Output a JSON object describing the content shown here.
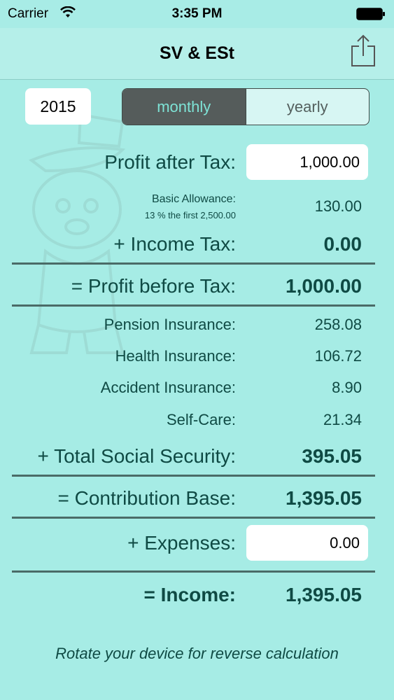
{
  "status_bar": {
    "carrier": "Carrier",
    "time": "3:35 PM"
  },
  "nav": {
    "title": "SV & ESt",
    "share_icon": "share-icon"
  },
  "controls": {
    "year": "2015",
    "segments": [
      "monthly",
      "yearly"
    ],
    "selected_segment": "monthly"
  },
  "rows": {
    "profit_after_tax": {
      "label": "Profit after Tax:",
      "value": "1,000.00"
    },
    "basic_allowance": {
      "label": "Basic Allowance:",
      "sublabel": "13 % the first 2,500.00",
      "value": "130.00"
    },
    "income_tax": {
      "label": "+ Income Tax:",
      "value": "0.00"
    },
    "profit_before_tax": {
      "label": "= Profit before Tax:",
      "value": "1,000.00"
    },
    "pension_insurance": {
      "label": "Pension Insurance:",
      "value": "258.08"
    },
    "health_insurance": {
      "label": "Health Insurance:",
      "value": "106.72"
    },
    "accident_insurance": {
      "label": "Accident Insurance:",
      "value": "8.90"
    },
    "self_care": {
      "label": "Self-Care:",
      "value": "21.34"
    },
    "total_social_security": {
      "label": "+ Total Social Security:",
      "value": "395.05"
    },
    "contribution_base": {
      "label": "= Contribution Base:",
      "value": "1,395.05"
    },
    "expenses": {
      "label": "+ Expenses:",
      "value": "0.00"
    },
    "income": {
      "label": "= Income:",
      "value": "1,395.05"
    }
  },
  "hint": "Rotate your device for reverse calculation",
  "colors": {
    "background": "#a6ece5",
    "text": "#0f4a44",
    "segment_active_bg": "#555c5b",
    "segment_active_text": "#7ee3d6"
  }
}
